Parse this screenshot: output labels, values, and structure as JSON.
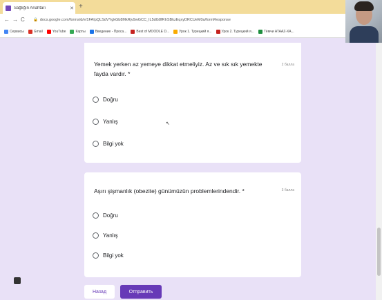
{
  "browser": {
    "tab_title": "Sağlığın Anahtarı",
    "url": "docs.google.com/forms/d/e/1FAIpQLSdVYgkGb8MkRjv9wGCC_IL5dG8fRIrSBkzEqxyDRCUeM0a/formResponse",
    "bookmarks": [
      "Сервисы",
      "Gmail",
      "YouTube",
      "Карты",
      "Введение - Проса...",
      "Best of MOODLE D...",
      "Урок 1. Турецкий я...",
      "Урок 2. Турецкий я...",
      "Тёмчи ATAAZ-ХА..."
    ]
  },
  "questions": [
    {
      "text": "Yemek yerken az yemeye dikkat etmeliyiz. Az ve sık sık yemekte fayda vardır. *",
      "points": "2 балла",
      "options": [
        "Doğru",
        "Yanlış",
        "Bilgi yok"
      ]
    },
    {
      "text": "Aşırı şişmanlık (obezite) günümüzün problemlerindendir. *",
      "points": "3 балла",
      "options": [
        "Doğru",
        "Yanlış",
        "Bilgi yok"
      ]
    }
  ],
  "footer": {
    "back_label": "Назад",
    "submit_label": "Отправить"
  },
  "colors": {
    "accent": "#673ab7",
    "page_bg": "#e9e1f7",
    "tabbar_bg": "#f3dc9a"
  }
}
